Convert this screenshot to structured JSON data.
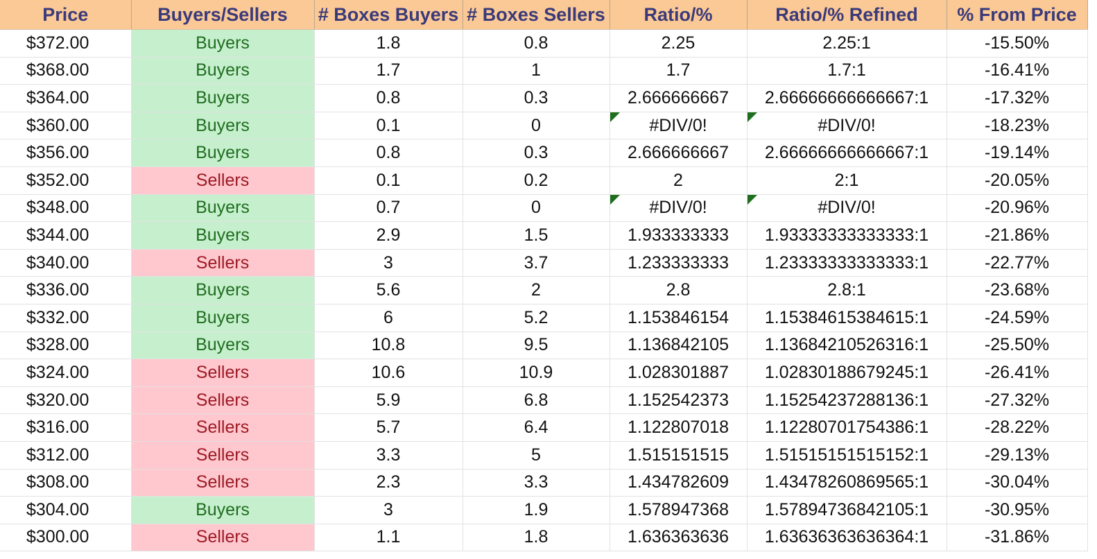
{
  "columns": [
    "Price",
    "Buyers/Sellers",
    "# Boxes Buyers",
    "# Boxes Sellers",
    "Ratio/%",
    "Ratio/% Refined",
    "% From Price"
  ],
  "colors": {
    "buyers_fill": "#c6efce",
    "buyers_text": "#1f6e1f",
    "sellers_fill": "#ffc7ce",
    "sellers_text": "#9c1a24",
    "header_fill": "#fbc995",
    "header_text": "#3a3a7a"
  },
  "rows": [
    {
      "price": "$372.00",
      "side": "Buyers",
      "boxes_buyers": "1.8",
      "boxes_sellers": "0.8",
      "ratio": "2.25",
      "ratio_refined": "2.25:1",
      "from_price": "-15.50%"
    },
    {
      "price": "$368.00",
      "side": "Buyers",
      "boxes_buyers": "1.7",
      "boxes_sellers": "1",
      "ratio": "1.7",
      "ratio_refined": "1.7:1",
      "from_price": "-16.41%"
    },
    {
      "price": "$364.00",
      "side": "Buyers",
      "boxes_buyers": "0.8",
      "boxes_sellers": "0.3",
      "ratio": "2.666666667",
      "ratio_refined": "2.66666666666667:1",
      "from_price": "-17.32%"
    },
    {
      "price": "$360.00",
      "side": "Buyers",
      "boxes_buyers": "0.1",
      "boxes_sellers": "0",
      "ratio": "#DIV/0!",
      "ratio_refined": "#DIV/0!",
      "from_price": "-18.23%"
    },
    {
      "price": "$356.00",
      "side": "Buyers",
      "boxes_buyers": "0.8",
      "boxes_sellers": "0.3",
      "ratio": "2.666666667",
      "ratio_refined": "2.66666666666667:1",
      "from_price": "-19.14%"
    },
    {
      "price": "$352.00",
      "side": "Sellers",
      "boxes_buyers": "0.1",
      "boxes_sellers": "0.2",
      "ratio": "2",
      "ratio_refined": "2:1",
      "from_price": "-20.05%"
    },
    {
      "price": "$348.00",
      "side": "Buyers",
      "boxes_buyers": "0.7",
      "boxes_sellers": "0",
      "ratio": "#DIV/0!",
      "ratio_refined": "#DIV/0!",
      "from_price": "-20.96%"
    },
    {
      "price": "$344.00",
      "side": "Buyers",
      "boxes_buyers": "2.9",
      "boxes_sellers": "1.5",
      "ratio": "1.933333333",
      "ratio_refined": "1.93333333333333:1",
      "from_price": "-21.86%"
    },
    {
      "price": "$340.00",
      "side": "Sellers",
      "boxes_buyers": "3",
      "boxes_sellers": "3.7",
      "ratio": "1.233333333",
      "ratio_refined": "1.23333333333333:1",
      "from_price": "-22.77%"
    },
    {
      "price": "$336.00",
      "side": "Buyers",
      "boxes_buyers": "5.6",
      "boxes_sellers": "2",
      "ratio": "2.8",
      "ratio_refined": "2.8:1",
      "from_price": "-23.68%"
    },
    {
      "price": "$332.00",
      "side": "Buyers",
      "boxes_buyers": "6",
      "boxes_sellers": "5.2",
      "ratio": "1.153846154",
      "ratio_refined": "1.15384615384615:1",
      "from_price": "-24.59%"
    },
    {
      "price": "$328.00",
      "side": "Buyers",
      "boxes_buyers": "10.8",
      "boxes_sellers": "9.5",
      "ratio": "1.136842105",
      "ratio_refined": "1.13684210526316:1",
      "from_price": "-25.50%"
    },
    {
      "price": "$324.00",
      "side": "Sellers",
      "boxes_buyers": "10.6",
      "boxes_sellers": "10.9",
      "ratio": "1.028301887",
      "ratio_refined": "1.02830188679245:1",
      "from_price": "-26.41%"
    },
    {
      "price": "$320.00",
      "side": "Sellers",
      "boxes_buyers": "5.9",
      "boxes_sellers": "6.8",
      "ratio": "1.152542373",
      "ratio_refined": "1.15254237288136:1",
      "from_price": "-27.32%"
    },
    {
      "price": "$316.00",
      "side": "Sellers",
      "boxes_buyers": "5.7",
      "boxes_sellers": "6.4",
      "ratio": "1.122807018",
      "ratio_refined": "1.12280701754386:1",
      "from_price": "-28.22%"
    },
    {
      "price": "$312.00",
      "side": "Sellers",
      "boxes_buyers": "3.3",
      "boxes_sellers": "5",
      "ratio": "1.515151515",
      "ratio_refined": "1.51515151515152:1",
      "from_price": "-29.13%"
    },
    {
      "price": "$308.00",
      "side": "Sellers",
      "boxes_buyers": "2.3",
      "boxes_sellers": "3.3",
      "ratio": "1.434782609",
      "ratio_refined": "1.43478260869565:1",
      "from_price": "-30.04%"
    },
    {
      "price": "$304.00",
      "side": "Buyers",
      "boxes_buyers": "3",
      "boxes_sellers": "1.9",
      "ratio": "1.578947368",
      "ratio_refined": "1.57894736842105:1",
      "from_price": "-30.95%"
    },
    {
      "price": "$300.00",
      "side": "Sellers",
      "boxes_buyers": "1.1",
      "boxes_sellers": "1.8",
      "ratio": "1.636363636",
      "ratio_refined": "1.63636363636364:1",
      "from_price": "-31.86%"
    }
  ]
}
